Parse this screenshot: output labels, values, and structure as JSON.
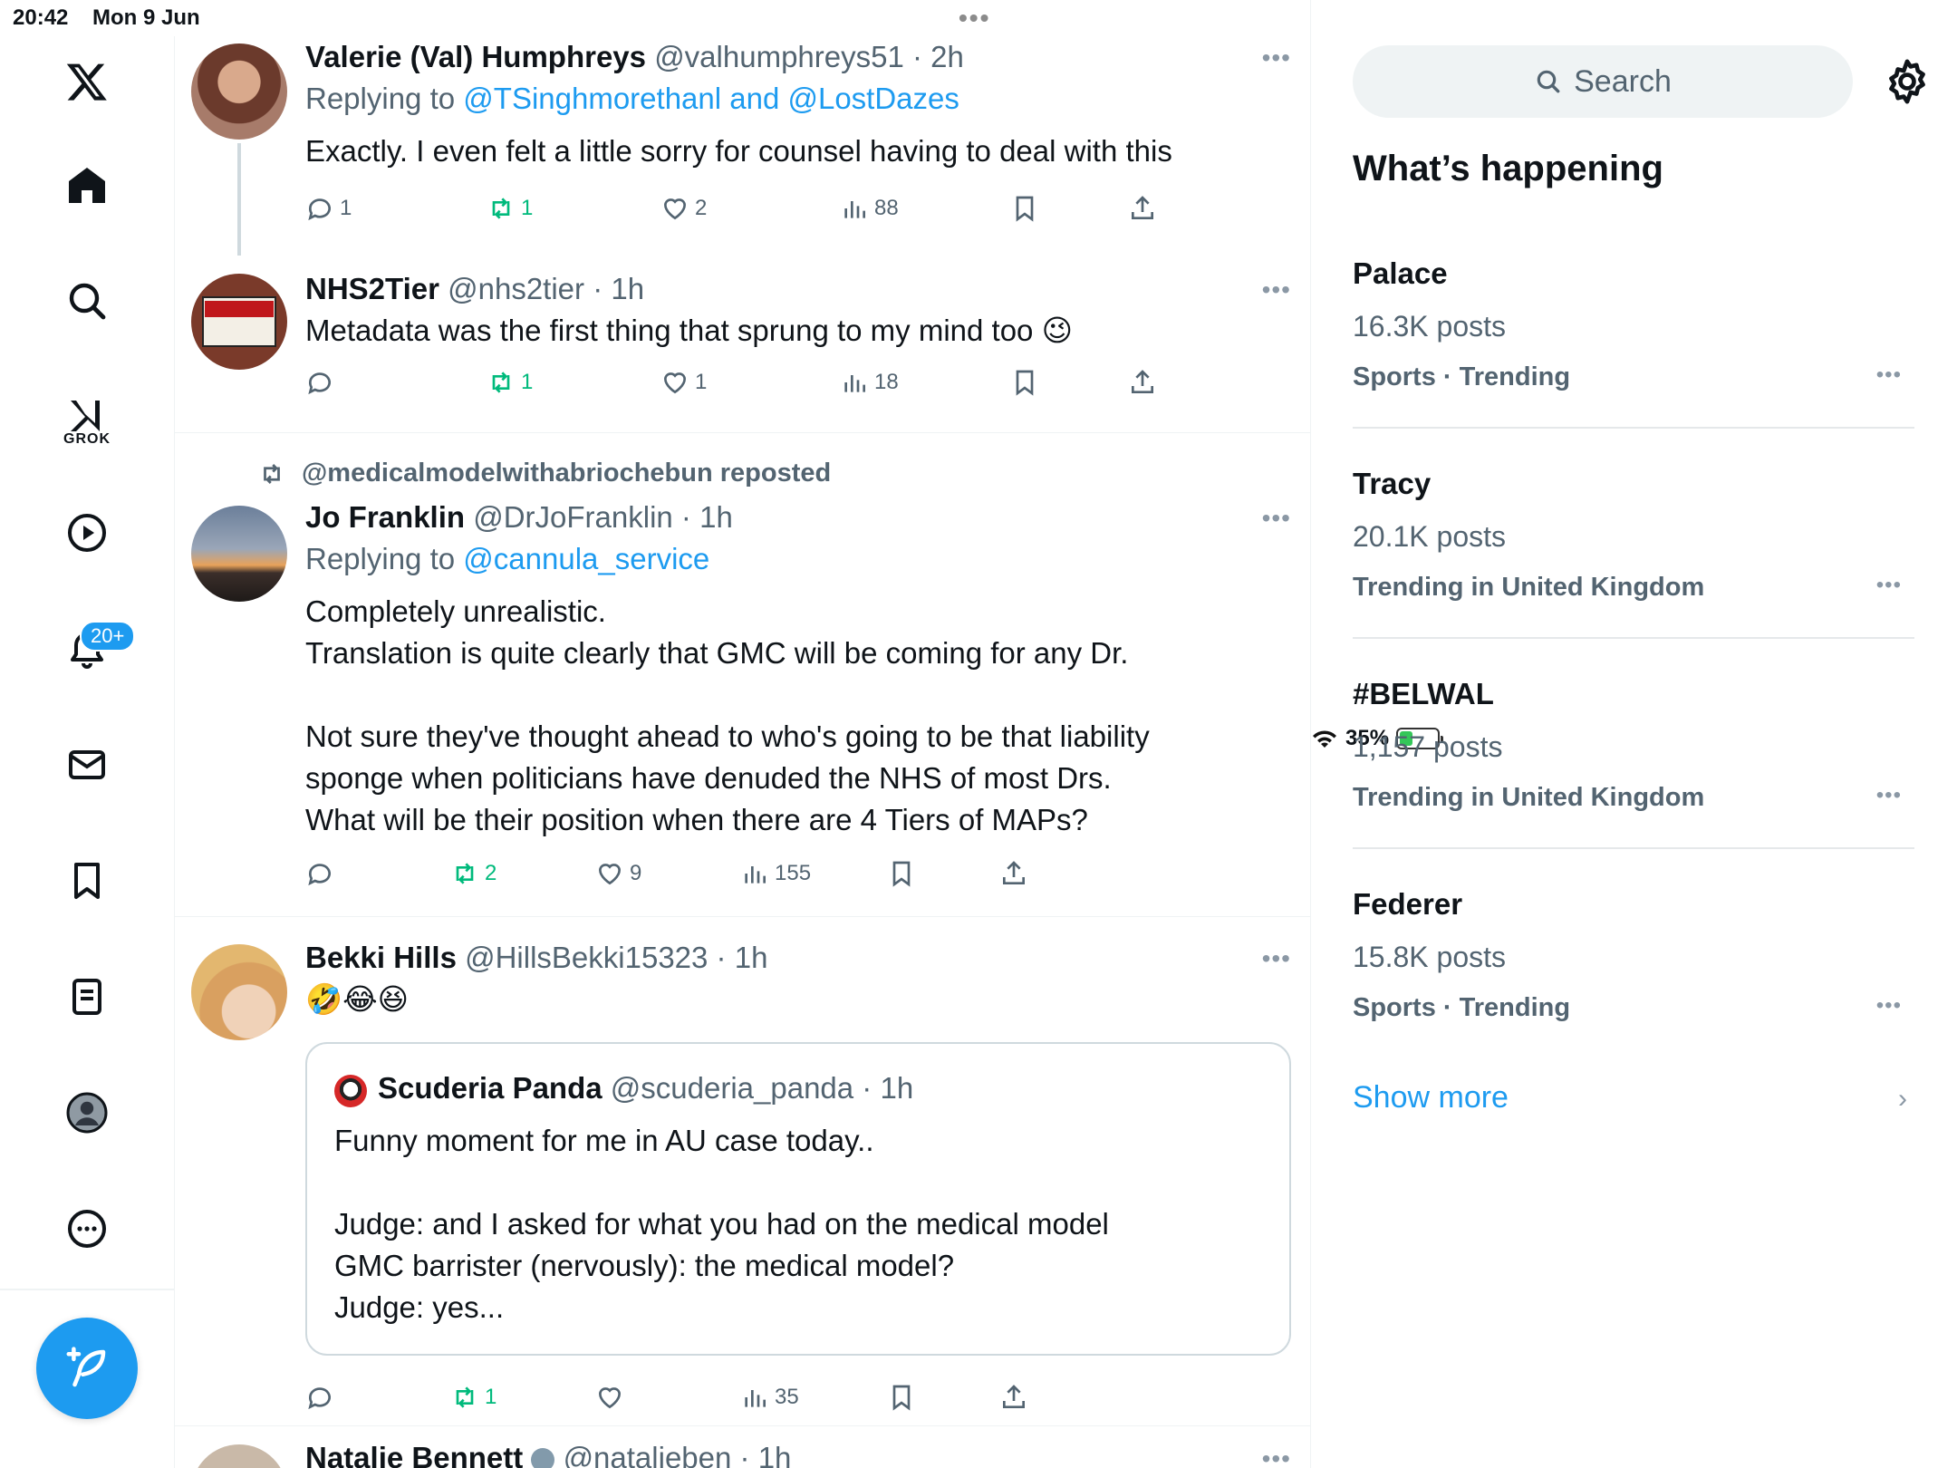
{
  "status": {
    "time": "20:42",
    "date": "Mon 9 Jun",
    "battery": "35%",
    "battery_level": 0.35
  },
  "nav": {
    "notifications_badge": "20+",
    "grok_label": "GROK"
  },
  "tweets": [
    {
      "name": "Valerie (Val) Humphreys",
      "handle": "@valhumphreys51",
      "time": "2h",
      "replying_label": "Replying to",
      "replying_to": "@TSinghmorethanl and @LostDazes",
      "text": "Exactly. I even felt a little sorry for counsel having to deal with this",
      "replies": "1",
      "reposts": "1",
      "likes": "2",
      "views": "88"
    },
    {
      "name": "NHS2Tier",
      "handle": "@nhs2tier",
      "time": "1h",
      "text": "Metadata was the first thing that sprung to my mind too 😉",
      "replies": "",
      "reposts": "1",
      "likes": "1",
      "views": "18"
    },
    {
      "reposted_by": "@medicalmodelwithabriochebun reposted",
      "name": "Jo Franklin",
      "handle": "@DrJoFranklin",
      "time": "1h",
      "replying_label": "Replying to",
      "replying_to": "@cannula_service",
      "text_lines": [
        "Completely unrealistic.",
        "Translation is quite clearly that GMC will be coming for any Dr.",
        "",
        "Not sure they've thought ahead to who's going to be that liability",
        "sponge when politicians have denuded the NHS of most Drs.",
        "What will be their position when there are 4 Tiers of MAPs?"
      ],
      "replies": "",
      "reposts": "2",
      "likes": "9",
      "views": "155"
    },
    {
      "name": "Bekki Hills",
      "handle": "@HillsBekki15323",
      "time": "1h",
      "text": "🤣😂😆",
      "quote": {
        "name": "Scuderia Panda",
        "handle": "@scuderia_panda",
        "time": "1h",
        "text_lines": [
          "Funny moment for me in AU case today..",
          "",
          "Judge: and I asked for what you had on the medical model",
          "GMC barrister (nervously): the medical model?",
          "Judge: yes..."
        ]
      },
      "replies": "",
      "reposts": "1",
      "likes": "",
      "views": "35"
    },
    {
      "name": "Natalie Bennett",
      "handle": "@natalieben",
      "time": "1h"
    }
  ],
  "right": {
    "search_placeholder": "Search",
    "heading": "What’s happening",
    "trends": [
      {
        "name": "Palace",
        "count": "16.3K posts",
        "context": "Sports · Trending"
      },
      {
        "name": "Tracy",
        "count": "20.1K posts",
        "context": "Trending in United Kingdom"
      },
      {
        "name": "#BELWAL",
        "count": "1,157 posts",
        "context": "Trending in United Kingdom"
      },
      {
        "name": "Federer",
        "count": "15.8K posts",
        "context": "Sports · Trending"
      }
    ],
    "show_more": "Show more"
  },
  "colors": {
    "accent": "#1d9bf0",
    "repost_green": "#00ba7c",
    "muted": "#536471"
  }
}
